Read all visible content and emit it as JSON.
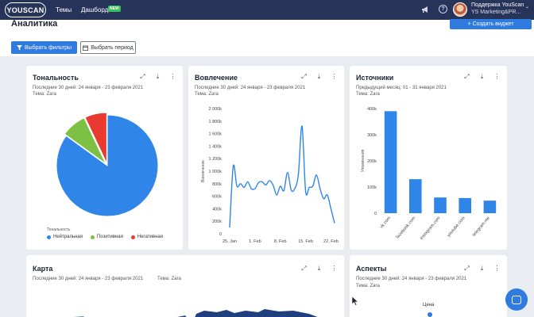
{
  "topbar": {
    "logo": "YOUSCAN",
    "nav": [
      "Темы",
      "Дашборды"
    ],
    "nav_badge": "NEW",
    "user_name": "Поддержка YouScan",
    "user_org": "YS Marketing&PR...",
    "icons": [
      "megaphone-icon",
      "bell-icon",
      "help-icon",
      "avatar",
      "chevron-down-icon"
    ]
  },
  "page": {
    "title": "Аналитика",
    "create_widget": "+ Создать виджет",
    "filter_btn": "Выбрать фильтры",
    "period_btn": "Выбрать период"
  },
  "cards": {
    "tonality": {
      "title": "Тональность",
      "meta1": "Последние 30 дней: 24 января - 23 февраля 2021",
      "meta2": "Тема: Zara",
      "legend_title": "Тональность",
      "legend": [
        "Нейтральная",
        "Позитивная",
        "Негативная"
      ],
      "colors": [
        "#2f86e8",
        "#7cc144",
        "#e83a2f"
      ]
    },
    "engagement": {
      "title": "Вовлечение",
      "meta1": "Последние 30 дней: 24 января - 23 февраля 2021",
      "meta2": "Тема: Zara",
      "ylabel": "Вовлечение"
    },
    "sources": {
      "title": "Источники",
      "meta1": "Предыдущий месяц: 01 - 31 января 2021",
      "meta2": "Тема: Zara",
      "ylabel": "Упоминания"
    },
    "map": {
      "title": "Карта",
      "meta1": "Последние 30 дней: 24 января - 23 февраля 2021",
      "meta2": "Тема: Zara"
    },
    "aspects": {
      "title": "Аспекты",
      "meta1": "Последние 30 дней: 24 января - 23 февраля 2021",
      "meta2": "Тема: Zara",
      "label": "Цена"
    }
  },
  "chart_data": [
    {
      "type": "pie",
      "title": "Тональность",
      "categories": [
        "Нейтральная",
        "Позитивная",
        "Негативная"
      ],
      "values": [
        85,
        8,
        7
      ]
    },
    {
      "type": "line",
      "title": "Вовлечение",
      "ylabel": "Вовлечение",
      "ylim": [
        0,
        2000000
      ],
      "yticks": [
        "0",
        "200k",
        "400k",
        "600k",
        "800k",
        "1 000k",
        "1 200k",
        "1 400k",
        "1 600k",
        "1 800k",
        "2 000k"
      ],
      "xticks": [
        "25. Jan",
        "1. Feb",
        "8. Feb",
        "15. Feb",
        "22. Feb"
      ],
      "x": [
        "25. Jan",
        "26. Jan",
        "27. Jan",
        "28. Jan",
        "29. Jan",
        "30. Jan",
        "31. Jan",
        "1. Feb",
        "2. Feb",
        "3. Feb",
        "4. Feb",
        "5. Feb",
        "6. Feb",
        "7. Feb",
        "8. Feb",
        "9. Feb",
        "10. Feb",
        "11. Feb",
        "12. Feb",
        "13. Feb",
        "14. Feb",
        "15. Feb",
        "16. Feb",
        "17. Feb",
        "18. Feb",
        "19. Feb",
        "20. Feb",
        "21. Feb",
        "22. Feb",
        "23. Feb"
      ],
      "values": [
        100000,
        1080000,
        760000,
        800000,
        740000,
        830000,
        720000,
        720000,
        820000,
        830000,
        780000,
        850000,
        780000,
        620000,
        760000,
        690000,
        980000,
        700000,
        720000,
        950000,
        1720000,
        680000,
        740000,
        760000,
        940000,
        720000,
        560000,
        620000,
        400000,
        170000
      ]
    },
    {
      "type": "bar",
      "title": "Источники",
      "ylabel": "Упоминания",
      "ylim": [
        0,
        400000
      ],
      "yticks": [
        "0",
        "100k",
        "200k",
        "300k",
        "400k"
      ],
      "categories": [
        "vk.com",
        "facebook.com",
        "instagram.com",
        "youtube.com",
        "telegram.me"
      ],
      "values": [
        390000,
        130000,
        60000,
        58000,
        48000
      ]
    }
  ]
}
